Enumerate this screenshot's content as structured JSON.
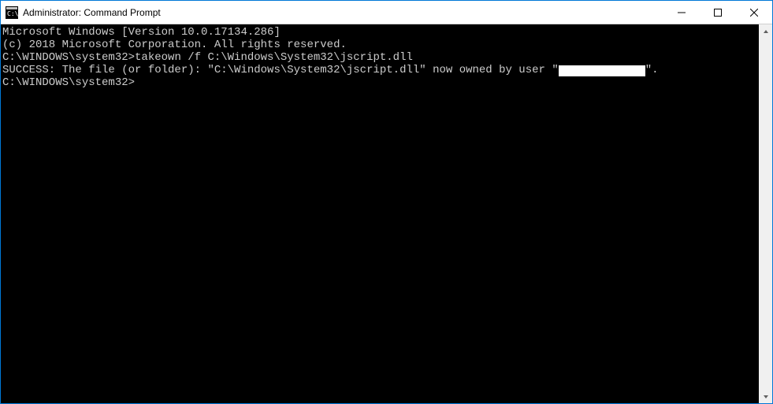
{
  "window": {
    "title": "Administrator: Command Prompt"
  },
  "terminal": {
    "line1": "Microsoft Windows [Version 10.0.17134.286]",
    "line2": "(c) 2018 Microsoft Corporation. All rights reserved.",
    "blank1": "",
    "prompt1_prefix": "C:\\WINDOWS\\system32>",
    "prompt1_cmd": "takeown /f C:\\Windows\\System32\\jscript.dll",
    "blank2": "",
    "success_pre": "SUCCESS: The file (or folder): \"C:\\Windows\\System32\\jscript.dll\" now owned by user \"",
    "success_post": "\".",
    "blank3": "",
    "prompt2_prefix": "C:\\WINDOWS\\system32>"
  }
}
